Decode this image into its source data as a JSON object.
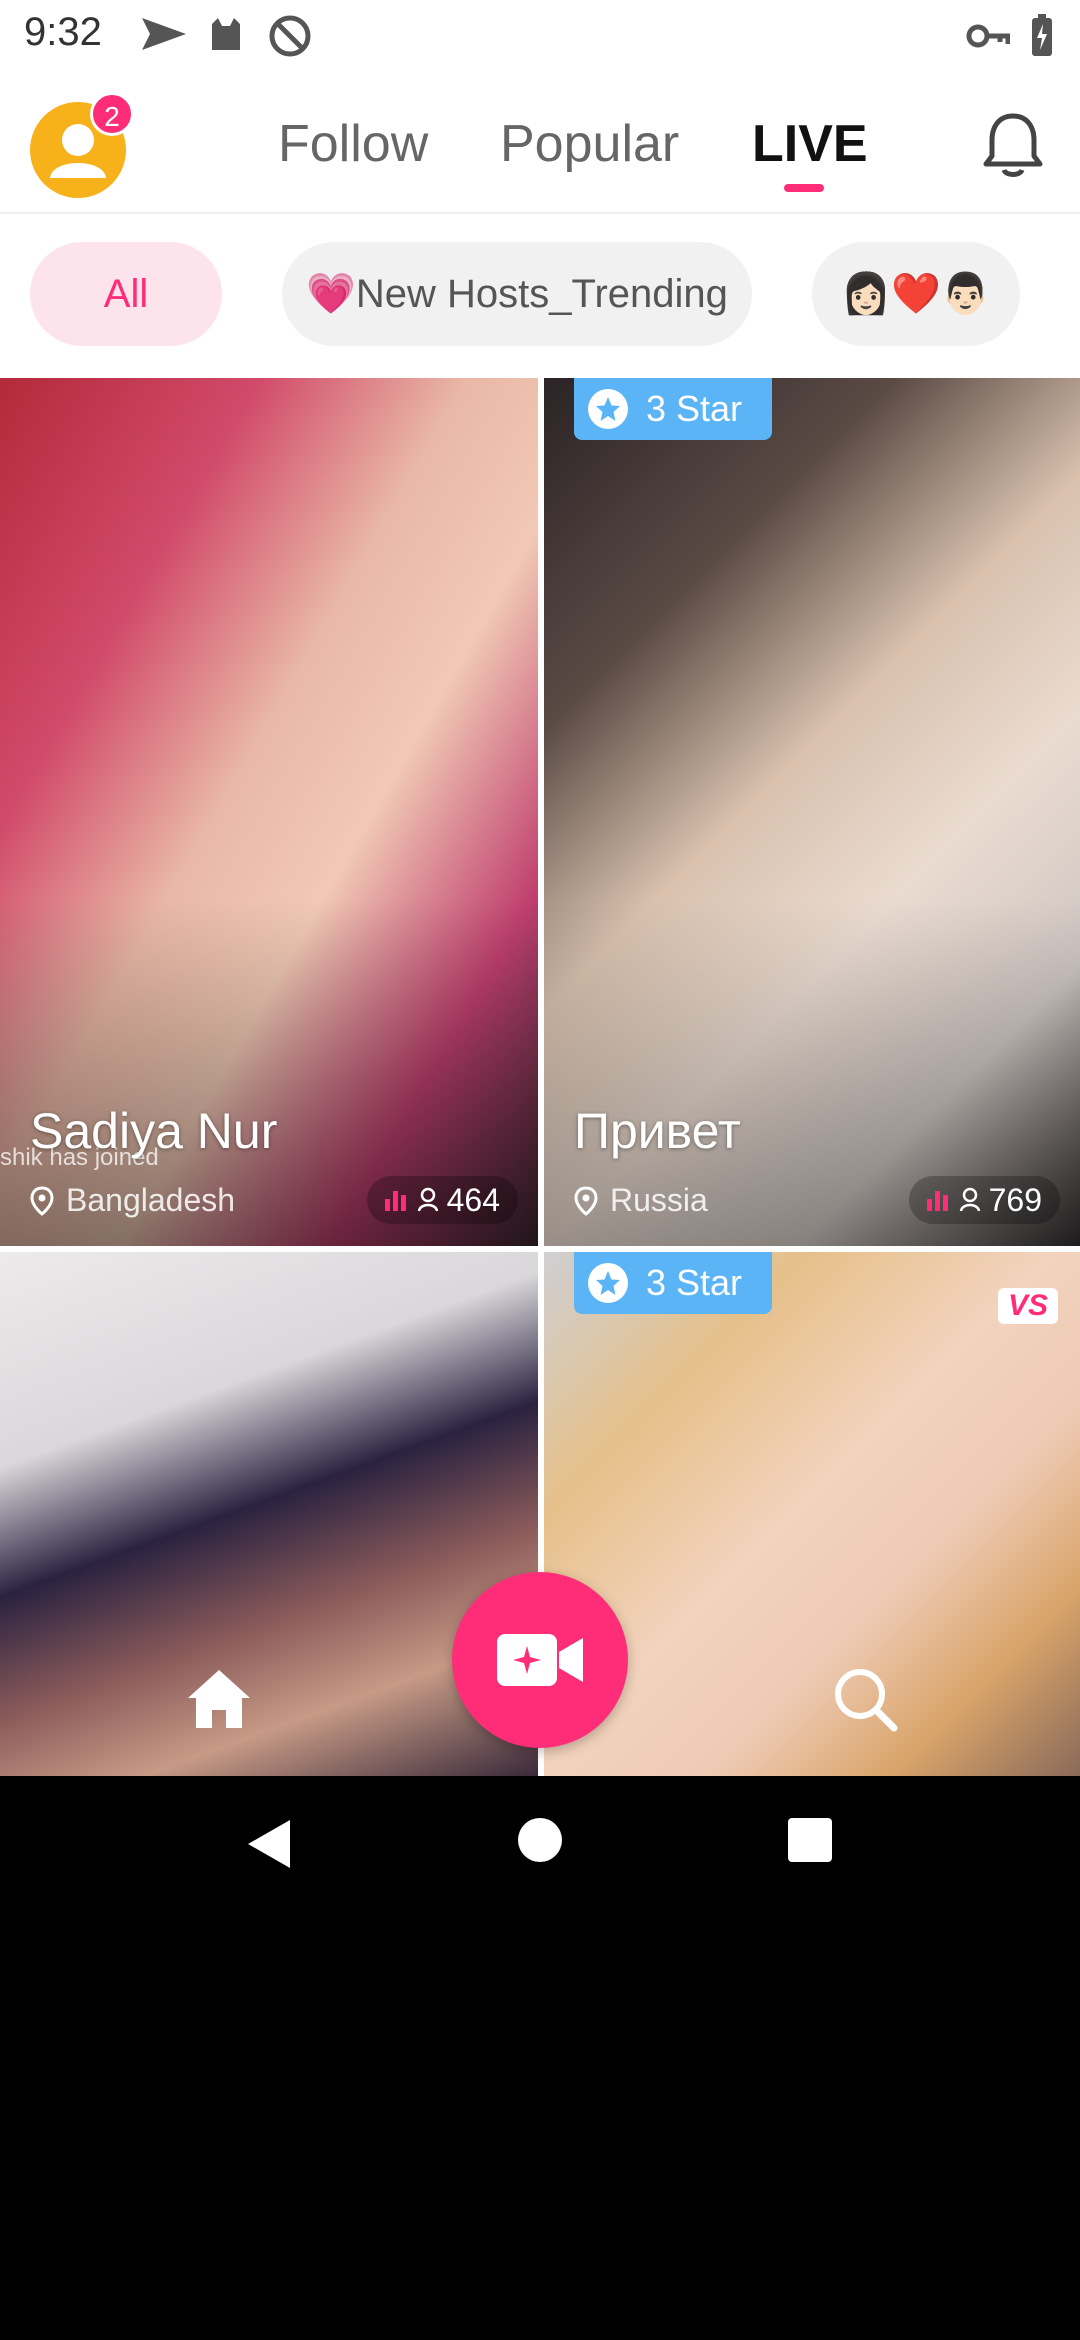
{
  "status_bar": {
    "time": "9:32"
  },
  "header": {
    "avatar_badge_count": "2",
    "tabs": [
      {
        "label": "Follow"
      },
      {
        "label": "Popular"
      },
      {
        "label": "LIVE"
      }
    ],
    "active_tab": "LIVE"
  },
  "filters": [
    {
      "label": "All"
    },
    {
      "label": "💗New Hosts_Trending"
    },
    {
      "label": "👩🏻❤️👨🏻"
    }
  ],
  "streams": [
    {
      "name": "Sadiya Nur",
      "location": "Bangladesh",
      "viewers": "464",
      "overlay": "shik has joined"
    },
    {
      "badge": "3 Star",
      "name": "Привет",
      "location": "Russia",
      "viewers": "769"
    },
    {
      "name": ""
    },
    {
      "badge": "3 Star",
      "tag": "VS"
    }
  ],
  "colors": {
    "accent": "#ff2d78",
    "star_badge": "#5ab4f5",
    "avatar": "#f7b21b"
  },
  "icons": {
    "home": "home-icon",
    "live": "video-camera-icon",
    "search": "search-icon",
    "bell": "bell-icon",
    "back": "back-triangle-icon",
    "home_sys": "home-circle-icon",
    "recents": "recents-square-icon"
  }
}
